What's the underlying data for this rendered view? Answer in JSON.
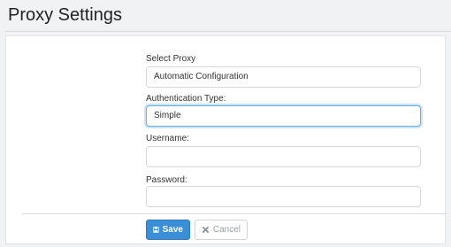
{
  "header": {
    "title": "Proxy Settings"
  },
  "form": {
    "select_proxy": {
      "label": "Select Proxy",
      "value": "Automatic Configuration"
    },
    "auth_type": {
      "label": "Authentication Type:",
      "value": "Simple"
    },
    "username": {
      "label": "Username:",
      "value": ""
    },
    "password": {
      "label": "Password:",
      "value": ""
    }
  },
  "actions": {
    "save_label": "Save",
    "save_icon": "floppy-disk-icon",
    "cancel_label": "Cancel",
    "cancel_icon": "times-icon"
  },
  "colors": {
    "primary": "#3a8fd6",
    "focus": "#66afe9"
  }
}
